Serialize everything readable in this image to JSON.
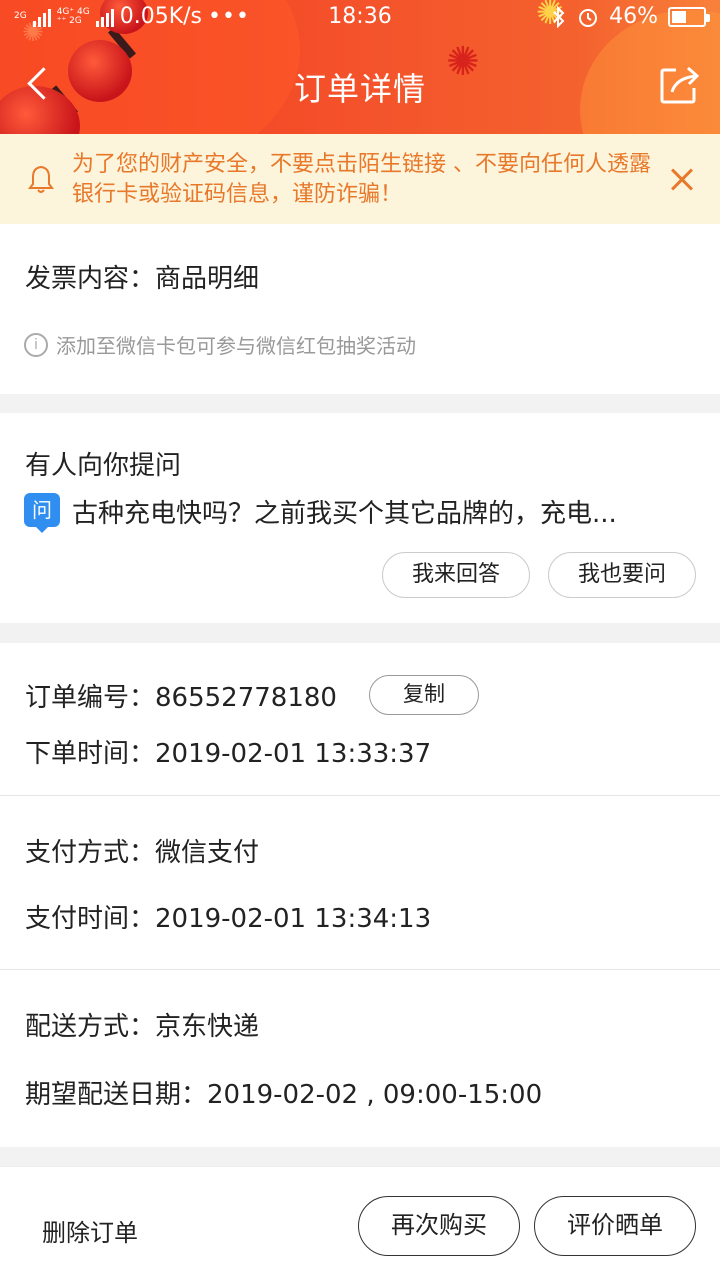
{
  "status_bar": {
    "network_left": "2G",
    "network_mid_top": "4G⁺ 4G",
    "network_mid_bottom": "⁺⁺ 2G",
    "speed": "0.05K/s",
    "dots": "•••",
    "time": "18:36",
    "battery": "46%",
    "battery_level": 0.46
  },
  "nav": {
    "title": "订单详情"
  },
  "notice": {
    "text": "为了您的财产安全，不要点击陌生链接 、不要向任何人透露银行卡或验证码信息，谨防诈骗！"
  },
  "invoice": {
    "content": "发票内容：商品明细",
    "hint": "添加至微信卡包可参与微信红包抽奖活动",
    "info_glyph": "i"
  },
  "qa": {
    "heading": "有人向你提问",
    "q_badge": "问",
    "question": "古种充电快吗？之前我买个其它品牌的，充电...",
    "answer_label": "我来回答",
    "ask_label": "我也要问"
  },
  "order": {
    "number": "订单编号：86552778180",
    "copy_label": "复制",
    "time": "下单时间：2019-02-01 13:33:37"
  },
  "payment": {
    "method": "支付方式：微信支付",
    "time": "支付时间：2019-02-01 13:34:13"
  },
  "delivery": {
    "method": "配送方式：京东快递",
    "expected": "期望配送日期：2019-02-02 , 09:00-15:00"
  },
  "bottom": {
    "delete_label": "删除订单",
    "rebuy_label": "再次购买",
    "review_label": "评价晒单"
  },
  "colors": {
    "header_red": "#f0381f",
    "notice_bg": "#fdf4dc",
    "notice_text": "#e8782a",
    "question_badge": "#2f8ef0"
  }
}
